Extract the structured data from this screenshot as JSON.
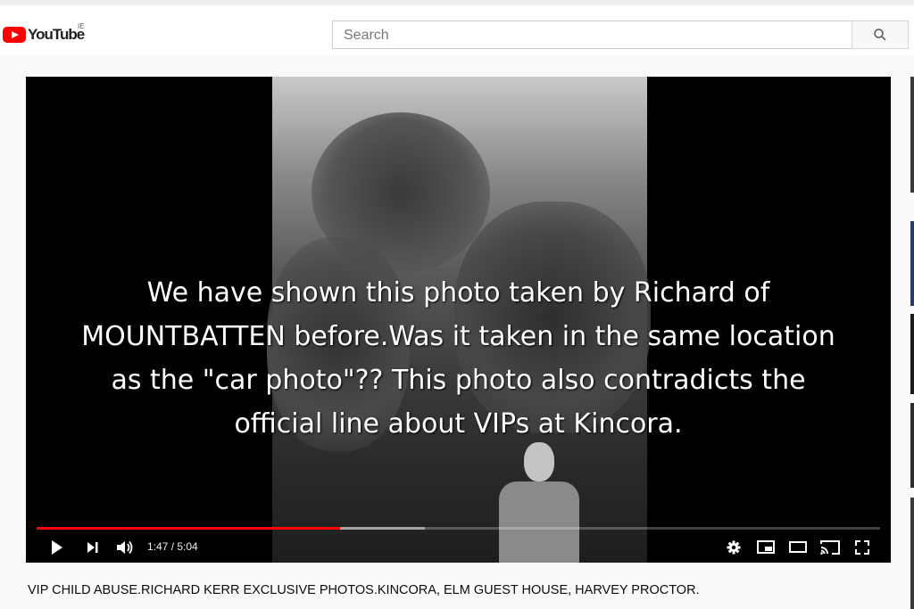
{
  "header": {
    "logo_text": "YouTube",
    "country_code": "IE",
    "search_placeholder": "Search",
    "search_icon": "search-icon"
  },
  "video": {
    "caption": "We have shown this photo taken by Richard of MOUNTBATTEN before.Was it taken in the same location as the \"car photo\"?? This photo also contradicts the official line about VIPs at Kincora.",
    "caption_lines": [
      "We have shown this photo taken by Richard of",
      "MOUNTBATTEN before.Was it taken in the same location",
      "as the \"car photo\"?? This photo also contradicts the",
      "official line about VIPs at Kincora."
    ],
    "played_fraction": 0.36,
    "buffered_fraction": 0.46,
    "time_display": "1:47 / 5:04",
    "colors": {
      "progress": "#ff0000",
      "brand": "#ff0000"
    },
    "icons": [
      "play-icon",
      "next-icon",
      "volume-icon",
      "settings-icon",
      "miniplayer-icon",
      "theater-icon",
      "cast-icon",
      "fullscreen-icon"
    ]
  },
  "title": "VIP CHILD ABUSE.RICHARD KERR EXCLUSIVE PHOTOS.KINCORA, ELM GUEST HOUSE, HARVEY PROCTOR."
}
